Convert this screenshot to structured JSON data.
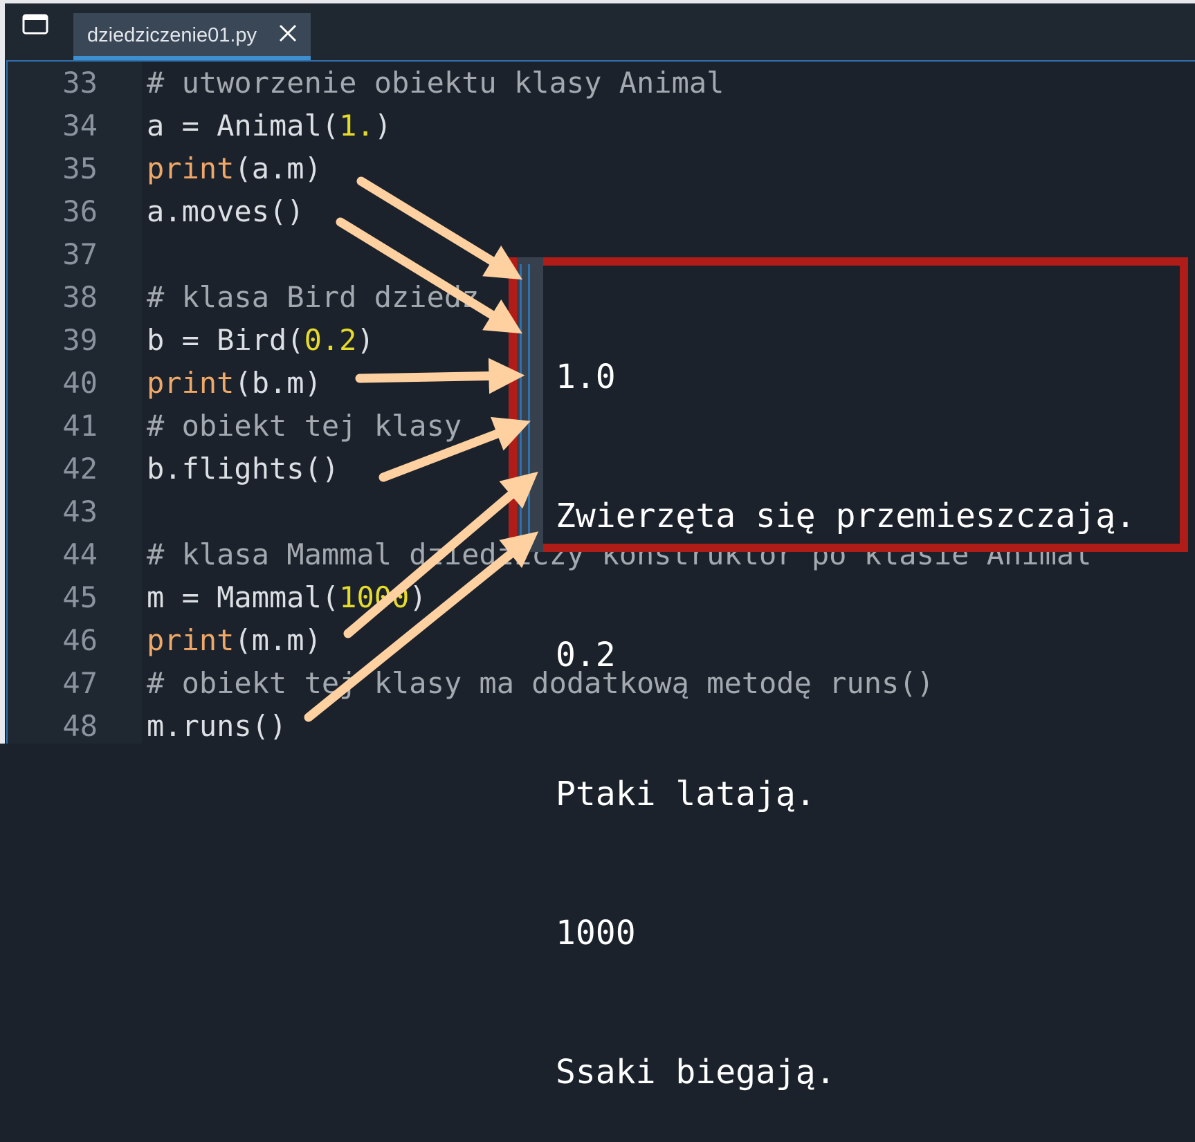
{
  "tab": {
    "filename": "dziedziczenie01.py"
  },
  "icons": {
    "window": "window-icon",
    "close": "close-icon"
  },
  "colors": {
    "background": "#1b222b",
    "gutter": "#1f2731",
    "accent": "#3e8fcf",
    "keyword": "#f0a868",
    "number": "#e6db2a",
    "comment": "#a3a9af",
    "output_border": "#b01c17",
    "arrow": "#ffd0a0"
  },
  "code_lines": [
    {
      "n": "33",
      "t": "# utworzenie obiektu klasy Animal"
    },
    {
      "n": "34",
      "t": "a = Animal(1.)"
    },
    {
      "n": "35",
      "t": "print(a.m)"
    },
    {
      "n": "36",
      "t": "a.moves()"
    },
    {
      "n": "37",
      "t": ""
    },
    {
      "n": "38",
      "t": "# klasa Bird dziedz"
    },
    {
      "n": "39",
      "t": "b = Bird(0.2)"
    },
    {
      "n": "40",
      "t": "print(b.m)"
    },
    {
      "n": "41",
      "t": "# obiekt tej klasy"
    },
    {
      "n": "42",
      "t": "b.flights()"
    },
    {
      "n": "43",
      "t": ""
    },
    {
      "n": "44",
      "t": "# klasa Mammal dziedziczy konstruktor po klasie Animal"
    },
    {
      "n": "45",
      "t": "m = Mammal(1000)"
    },
    {
      "n": "46",
      "t": "print(m.m)"
    },
    {
      "n": "47",
      "t": "# obiekt tej klasy ma dodatkową metodę runs()"
    },
    {
      "n": "48",
      "t": "m.runs()"
    }
  ],
  "output_lines": [
    "1.0",
    "Zwierzęta się przemieszczają.",
    "0.2",
    "Ptaki latają.",
    "1000",
    "Ssaki biegają."
  ]
}
